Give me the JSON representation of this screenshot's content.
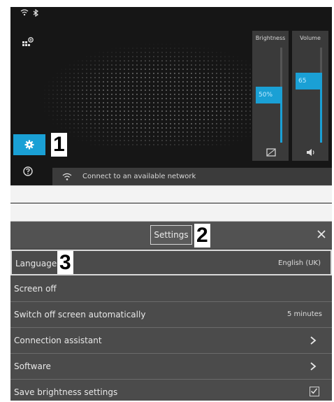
{
  "callouts": [
    "1",
    "2",
    "3"
  ],
  "sliders": {
    "brightness": {
      "title": "Brightness",
      "value_label": "50%",
      "level": 0.5
    },
    "volume": {
      "title": "Volume",
      "value_label": "65",
      "level": 0.65
    }
  },
  "wifi_banner": {
    "text": "Connect to an available network"
  },
  "settings": {
    "title": "Settings",
    "rows": [
      {
        "label": "Language",
        "value": "English (UK)"
      },
      {
        "label": "Screen off"
      },
      {
        "label": "Switch off screen automatically",
        "value": "5 minutes"
      },
      {
        "label": "Connection assistant",
        "accessory": "chevron-right-icon"
      },
      {
        "label": "Software",
        "accessory": "chevron-right-icon"
      },
      {
        "label": "Save brightness settings",
        "accessory": "checkbox-checked",
        "checked": true
      }
    ]
  },
  "colors": {
    "accent": "#1aa0d5",
    "panel": "#4b4b4b",
    "background": "#1f1f1f"
  }
}
